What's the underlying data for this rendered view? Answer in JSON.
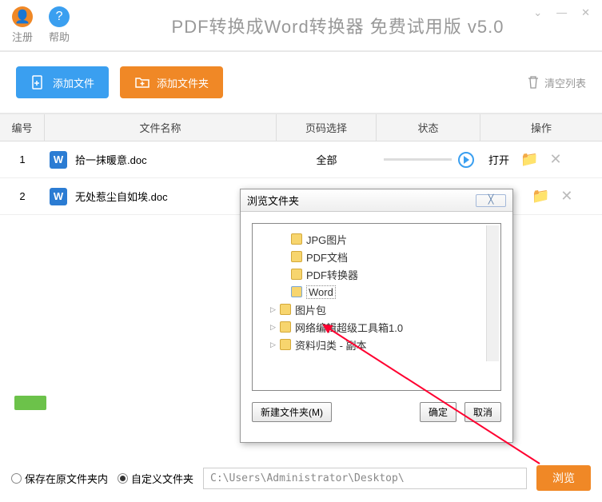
{
  "titlebar": {
    "register": "注册",
    "help": "帮助",
    "title": "PDF转换成Word转换器 免费试用版 v5.0"
  },
  "toolbar": {
    "add_file": "添加文件",
    "add_folder": "添加文件夹",
    "clear": "清空列表"
  },
  "columns": {
    "no": "编号",
    "name": "文件名称",
    "page": "页码选择",
    "status": "状态",
    "op": "操作"
  },
  "rows": [
    {
      "no": "1",
      "name": "拾一抹暖意.doc",
      "page": "全部",
      "open": "打开"
    },
    {
      "no": "2",
      "name": "无处惹尘自如埃.doc",
      "page": "",
      "open": ""
    }
  ],
  "dialog": {
    "title": "浏览文件夹",
    "items": [
      {
        "indent": 28,
        "label": "JPG图片",
        "exp": ""
      },
      {
        "indent": 28,
        "label": "PDF文档",
        "exp": ""
      },
      {
        "indent": 28,
        "label": "PDF转换器",
        "exp": ""
      },
      {
        "indent": 28,
        "label": "Word",
        "exp": "",
        "hl": true
      },
      {
        "indent": 14,
        "label": "图片包",
        "exp": "▷"
      },
      {
        "indent": 14,
        "label": "网络编辑超级工具箱1.0",
        "exp": "▷"
      },
      {
        "indent": 14,
        "label": "资料归类 - 副本",
        "exp": "▷"
      }
    ],
    "new_folder": "新建文件夹(M)",
    "ok": "确定",
    "cancel": "取消"
  },
  "bottom": {
    "opt1": "保存在原文件夹内",
    "opt2": "自定义文件夹",
    "path": "C:\\Users\\Administrator\\Desktop\\",
    "browse": "浏览"
  }
}
